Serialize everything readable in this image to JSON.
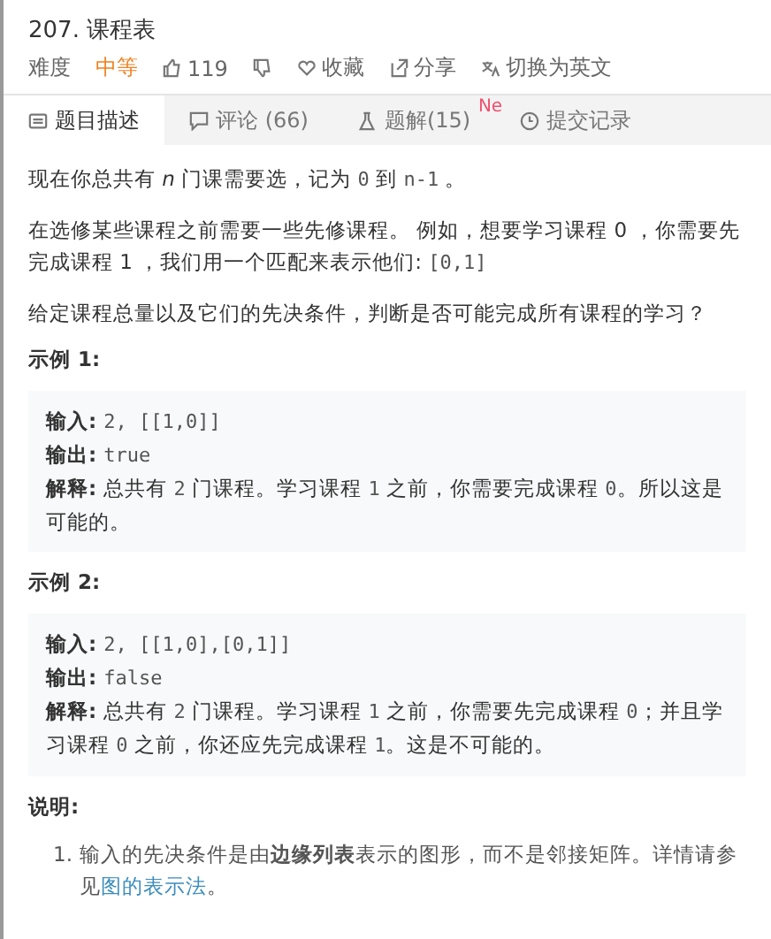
{
  "title": "207. 课程表",
  "meta": {
    "difficulty_label": "难度",
    "difficulty": "中等",
    "likes": "119",
    "favorite": "收藏",
    "share": "分享",
    "switch_language": "切换为英文"
  },
  "tabs": [
    {
      "label": "题目描述",
      "selected": true,
      "kind": "description"
    },
    {
      "label": "评论 (66)",
      "selected": false,
      "kind": "comment"
    },
    {
      "label": "题解(15)",
      "selected": false,
      "kind": "solution",
      "badge": "Ne"
    },
    {
      "label": "提交记录",
      "selected": false,
      "kind": "history"
    }
  ],
  "paragraphs": [
    [
      {
        "kind": "text",
        "text": "现在你总共有 "
      },
      {
        "kind": "italic",
        "text": "n"
      },
      {
        "kind": "text",
        "text": " 门课需要选，记为 "
      },
      {
        "kind": "code",
        "text": "0"
      },
      {
        "kind": "text",
        "text": " 到 "
      },
      {
        "kind": "code",
        "text": "n-1"
      },
      {
        "kind": "text",
        "text": " 。"
      }
    ],
    [
      {
        "kind": "text",
        "text": "在选修某些课程之前需要一些先修课程。 例如，想要学习课程 0 ，你需要先完成课程 1 ，我们用一个匹配来表示他们: "
      },
      {
        "kind": "code",
        "text": "[0,1]"
      }
    ],
    [
      {
        "kind": "text",
        "text": "给定课程总量以及它们的先决条件，判断是否可能完成所有课程的学习？"
      }
    ]
  ],
  "examples": [
    {
      "heading": "示例 1:",
      "lines": [
        [
          {
            "kind": "label",
            "text": "输入: "
          },
          {
            "kind": "code",
            "text": "2, [[1,0]]"
          }
        ],
        [
          {
            "kind": "label",
            "text": "输出: "
          },
          {
            "kind": "code",
            "text": "true"
          }
        ],
        [
          {
            "kind": "label",
            "text": "解释: "
          },
          {
            "kind": "text",
            "text": "总共有 "
          },
          {
            "kind": "code",
            "text": "2"
          },
          {
            "kind": "text",
            "text": " 门课程。学习课程 "
          },
          {
            "kind": "code",
            "text": "1"
          },
          {
            "kind": "text",
            "text": " 之前，你需要完成课程 "
          },
          {
            "kind": "code",
            "text": "0"
          },
          {
            "kind": "text",
            "text": "。所以这是可能的。"
          }
        ]
      ]
    },
    {
      "heading": "示例 2:",
      "lines": [
        [
          {
            "kind": "label",
            "text": "输入: "
          },
          {
            "kind": "code",
            "text": "2, [[1,0],[0,1]]"
          }
        ],
        [
          {
            "kind": "label",
            "text": "输出: "
          },
          {
            "kind": "code",
            "text": "false"
          }
        ],
        [
          {
            "kind": "label",
            "text": "解释: "
          },
          {
            "kind": "text",
            "text": "总共有 "
          },
          {
            "kind": "code",
            "text": "2"
          },
          {
            "kind": "text",
            "text": " 门课程。学习课程 "
          },
          {
            "kind": "code",
            "text": "1"
          },
          {
            "kind": "text",
            "text": " 之前，你需要先完成课程 "
          },
          {
            "kind": "code",
            "text": "0"
          },
          {
            "kind": "text",
            "text": "；并且学习课程 "
          },
          {
            "kind": "code",
            "text": "0"
          },
          {
            "kind": "text",
            "text": " 之前，你还应先完成课程 "
          },
          {
            "kind": "code",
            "text": "1"
          },
          {
            "kind": "text",
            "text": "。这是不可能的。"
          }
        ]
      ]
    }
  ],
  "notes": {
    "heading": "说明:",
    "items": [
      {
        "number": "1.",
        "segments": [
          {
            "kind": "text",
            "text": "输入的先决条件是由"
          },
          {
            "kind": "bold",
            "text": "边缘列表"
          },
          {
            "kind": "text",
            "text": "表示的图形，而不是邻接矩阵。详情请参见"
          },
          {
            "kind": "link",
            "text": "图的表示法"
          },
          {
            "kind": "text",
            "text": "。"
          }
        ]
      }
    ]
  }
}
